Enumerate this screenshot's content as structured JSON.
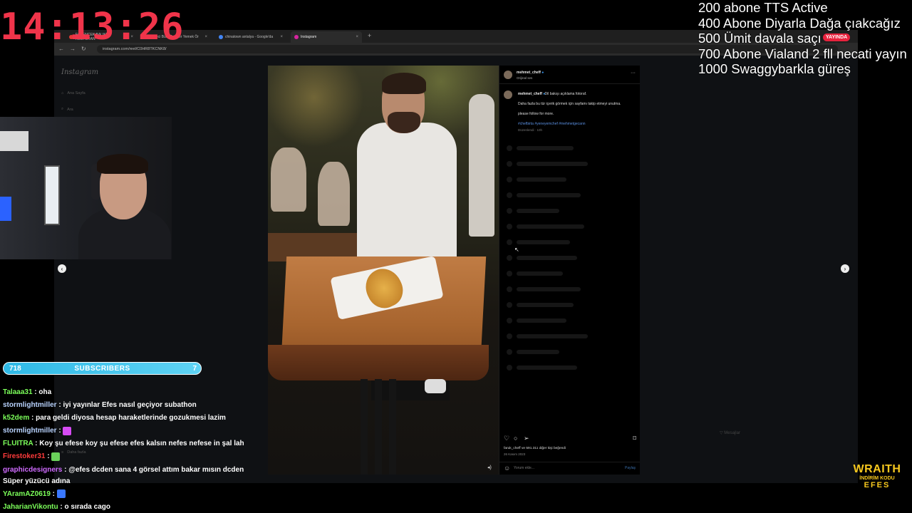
{
  "browser": {
    "tabs": [
      {
        "label": "EĞLENCEK BALIKLI RESTORAN",
        "color": "#e53935"
      },
      {
        "label": "Köfteci Bü... Popüler Yemek Ör",
        "color": "#e53935"
      },
      {
        "label": "chinatown antalya - Google'da",
        "color": "#4285f4"
      },
      {
        "label": "Instagram",
        "color": "#d6249f"
      }
    ],
    "url": "instagram.com/reel/C0HR8TKCNK8/"
  },
  "instagram": {
    "logo": "Instagram",
    "side_items": [
      "Ana Sayfa",
      "Ara"
    ],
    "more_label": "Daha fazla",
    "post": {
      "username": "mehmet_cheff",
      "subtitle": "Orijinal ses",
      "caption_lines": [
        "Dil bakışı açıklama fotoraf.",
        "Daha fazla bu tür içerik görmek için sayfamı takip etmeyi unutma.",
        "please follow for more."
      ],
      "hashtags": "#chefbirta #yeneyemchef #mehmetgecann",
      "caption_meta": "Düzenlendi · 10h",
      "likes": "faruk_cheff ve 591.311 diğer kişi beğendi",
      "date": "26 Kasım 2023",
      "comment_placeholder": "Yorum ekle...",
      "post_label": "Paylaş"
    },
    "messages_label": "Mesajlar"
  },
  "overlay": {
    "clock": "14:13:26",
    "goals": [
      "200 abone TTS Active",
      "400 Abone Diyarla Dağa çıakcağız",
      "500 Ümit davala saçı",
      "700 Abone Vialand 2 fll necati yayın",
      "1000 Swaggybarkla güreş"
    ],
    "live_badge": "YAYINDA",
    "subbar": {
      "left": "718",
      "label": "SUBSCRIBERS",
      "right": "7"
    },
    "sponsor": {
      "top": "WRAITH",
      "mid": "İNDİRİM KODU",
      "bot": "EFES"
    }
  },
  "chat": [
    {
      "user": "Talaaa31",
      "color": "#7cff5a",
      "msg": " : oha"
    },
    {
      "user": "stormlightmiller",
      "color": "#b9d3ff",
      "msg": " : iyi yayınlar Efes nasıl geçiyor subathon"
    },
    {
      "user": "k52dem",
      "color": "#7cff5a",
      "msg": " : para geldi diyosa hesap haraketlerinde gozukmesi lazim"
    },
    {
      "user": "stormlightmiller",
      "color": "#b9d3ff",
      "msg": " : ",
      "emote": "#d64bf3"
    },
    {
      "user": "FLUITRA",
      "color": "#7cff5a",
      "msg": " : Koy şu efese koy şu efese efes kalsın nefes nefese in şal lah"
    },
    {
      "user": "Firestoker31",
      "color": "#ff3b3b",
      "msg": " : ",
      "emote": "#6ad15a"
    },
    {
      "user": "graphicdesigners",
      "color": "#d06bff",
      "msg": " : @efes dcden sana 4 görsel attım bakar mısın dcden"
    },
    {
      "user": "",
      "color": "#ffffff",
      "msg": "Süper yüzücü adına"
    },
    {
      "user": "YAramAZ0619",
      "color": "#7cff5a",
      "msg": " : ",
      "emote": "#3a78ff"
    },
    {
      "user": "JaharianVikontu",
      "color": "#7cff5a",
      "msg": " : o sırada cago"
    }
  ]
}
